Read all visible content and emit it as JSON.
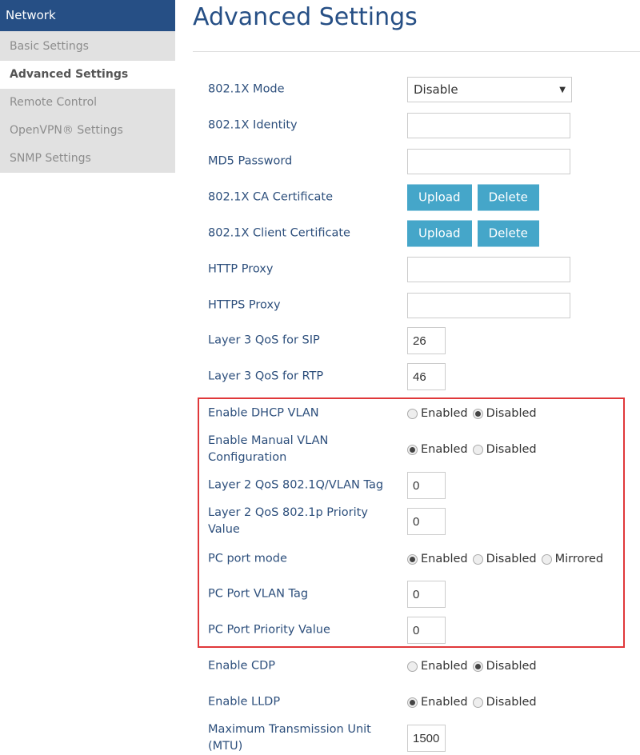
{
  "sidebar": {
    "header": "Network",
    "items": [
      {
        "label": "Basic Settings",
        "active": false
      },
      {
        "label": "Advanced Settings",
        "active": true
      },
      {
        "label": "Remote Control",
        "active": false
      },
      {
        "label": "OpenVPN® Settings",
        "active": false
      },
      {
        "label": "SNMP Settings",
        "active": false
      }
    ]
  },
  "page_title": "Advanced Settings",
  "highlight_color": "#e0383a",
  "rows": [
    {
      "label": "802.1X Mode",
      "type": "select",
      "value": "Disable"
    },
    {
      "label": "802.1X Identity",
      "type": "input",
      "value": ""
    },
    {
      "label": "MD5 Password",
      "type": "input",
      "value": ""
    },
    {
      "label": "802.1X CA Certificate",
      "type": "buttons",
      "buttons": [
        "Upload",
        "Delete"
      ]
    },
    {
      "label": "802.1X Client Certificate",
      "type": "buttons",
      "buttons": [
        "Upload",
        "Delete"
      ]
    },
    {
      "label": "HTTP Proxy",
      "type": "input",
      "value": ""
    },
    {
      "label": "HTTPS Proxy",
      "type": "input",
      "value": ""
    },
    {
      "label": "Layer 3 QoS for SIP",
      "type": "small",
      "value": "26"
    },
    {
      "label": "Layer 3 QoS for RTP",
      "type": "small",
      "value": "46"
    },
    {
      "label": "Enable DHCP VLAN",
      "type": "radio",
      "options": [
        "Enabled",
        "Disabled"
      ],
      "selected": "Disabled"
    },
    {
      "label": "Enable Manual VLAN Configuration",
      "type": "radio",
      "options": [
        "Enabled",
        "Disabled"
      ],
      "selected": "Enabled"
    },
    {
      "label": "Layer 2 QoS 802.1Q/VLAN Tag",
      "type": "small",
      "value": "0"
    },
    {
      "label": "Layer 2 QoS 802.1p Priority Value",
      "type": "small",
      "value": "0"
    },
    {
      "label": "PC port mode",
      "type": "radio",
      "options": [
        "Enabled",
        "Disabled",
        "Mirrored"
      ],
      "selected": "Enabled"
    },
    {
      "label": "PC Port VLAN Tag",
      "type": "small",
      "value": "0"
    },
    {
      "label": "PC Port Priority Value",
      "type": "small",
      "value": "0"
    },
    {
      "label": "Enable CDP",
      "type": "radio",
      "options": [
        "Enabled",
        "Disabled"
      ],
      "selected": "Disabled"
    },
    {
      "label": "Enable LLDP",
      "type": "radio",
      "options": [
        "Enabled",
        "Disabled"
      ],
      "selected": "Enabled"
    },
    {
      "label": "Maximum Transmission Unit (MTU)",
      "type": "small",
      "value": "1500"
    }
  ]
}
